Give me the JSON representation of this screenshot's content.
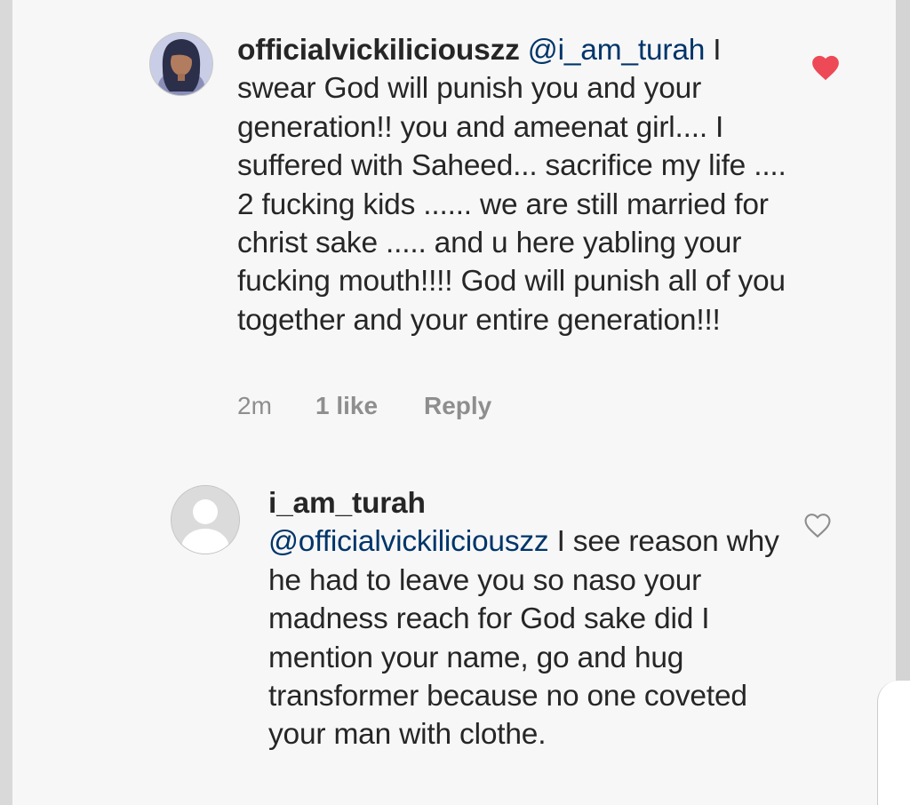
{
  "comments": [
    {
      "username": "officialvickiliciouszz",
      "mention": "@i_am_turah",
      "body": " I swear God will punish you and your generation!! you and ameenat girl.... I suffered with Saheed... sacrifice my life .... 2 fucking kids ...... we are still married for christ sake ..... and u here yabling your fucking mouth!!!! God will punish all of you together and your entire generation!!!",
      "time": "2m",
      "likes": "1 like",
      "reply_label": "Reply",
      "liked": true,
      "avatar": "profile-photo"
    },
    {
      "username": "i_am_turah",
      "mention": "@officialvickiliciouszz",
      "body": " I see reason why he had to leave you so naso your madness reach for God sake did I mention your name, go and hug transformer because no one coveted your man with clothe.",
      "liked": false,
      "avatar": "default-avatar"
    }
  ],
  "icons": {
    "like_filled": "heart-filled-icon",
    "like_outline": "heart-outline-icon"
  },
  "colors": {
    "mention": "#003569",
    "heart_liked": "#ed4956",
    "meta_text": "#8e8e8e"
  }
}
